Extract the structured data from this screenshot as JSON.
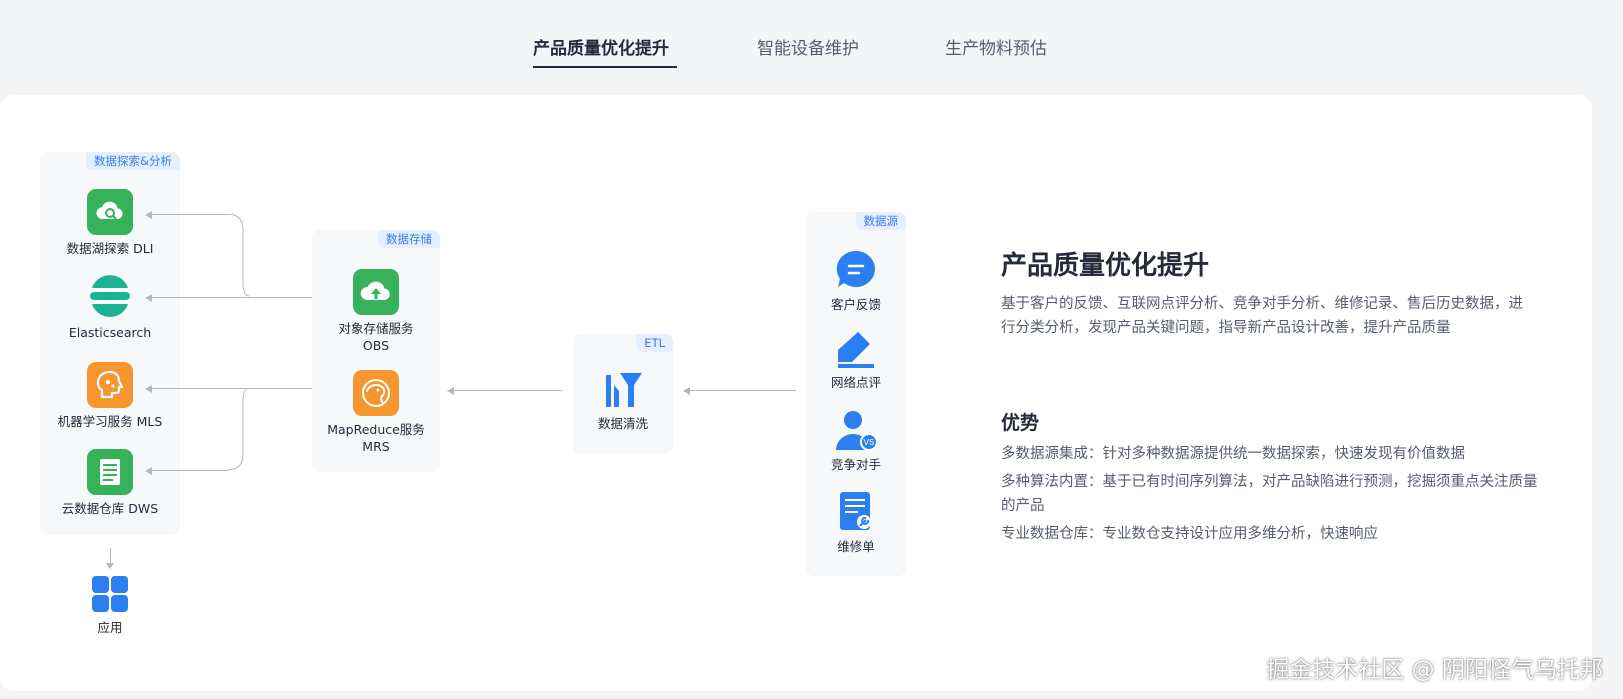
{
  "tabs": [
    {
      "label": "产品质量优化提升",
      "active": true
    },
    {
      "label": "智能设备维护",
      "active": false
    },
    {
      "label": "生产物料预估",
      "active": false
    }
  ],
  "diagram": {
    "analysis": {
      "tag": "数据探索&分析",
      "items": [
        {
          "label": "数据湖探索 DLI",
          "icon": "cloud-search-icon",
          "color": "#36b25a"
        },
        {
          "label": "Elasticsearch",
          "icon": "elasticsearch-icon",
          "color": "#1ab394"
        },
        {
          "label": "机器学习服务 MLS",
          "icon": "brain-icon",
          "color": "#f7962f"
        },
        {
          "label": "云数据仓库 DWS",
          "icon": "document-stack-icon",
          "color": "#36b25a"
        }
      ]
    },
    "app": {
      "label": "应用",
      "icon": "grid-icon",
      "color": "#2b7ff1"
    },
    "storage": {
      "tag": "数据存储",
      "items": [
        {
          "label_line1": "对象存储服务",
          "label_line2": "OBS",
          "icon": "cloud-upload-icon",
          "color": "#36b25a"
        },
        {
          "label_line1": "MapReduce服务",
          "label_line2": "MRS",
          "icon": "elephant-icon",
          "color": "#f7962f"
        }
      ]
    },
    "etl": {
      "tag": "ETL",
      "item": {
        "label": "数据清洗",
        "icon": "filter-icon",
        "color": "#2b7ff1"
      }
    },
    "sources": {
      "tag": "数据源",
      "items": [
        {
          "label": "客户反馈",
          "icon": "chat-bubble-icon",
          "color": "#2b7ff1"
        },
        {
          "label": "网络点评",
          "icon": "pencil-icon",
          "color": "#2b7ff1"
        },
        {
          "label": "竞争对手",
          "icon": "person-vs-icon",
          "color": "#2b7ff1"
        },
        {
          "label": "维修单",
          "icon": "wrench-doc-icon",
          "color": "#2b7ff1"
        }
      ]
    }
  },
  "detail": {
    "title": "产品质量优化提升",
    "description": "基于客户的反馈、互联网点评分析、竞争对手分析、维修记录、售后历史数据，进行分类分析，发现产品关键问题，指导新产品设计改善，提升产品质量",
    "advantages_title": "优势",
    "advantages": [
      "多数据源集成：针对多种数据源提供统一数据探索，快速发现有价值数据",
      "多种算法内置：基于已有时间序列算法，对产品缺陷进行预测，挖掘须重点关注质量的产品",
      "专业数据仓库：专业数仓支持设计应用多维分析，快速响应"
    ]
  },
  "watermark": "掘金技术社区 @ 阴阳怪气乌托邦"
}
